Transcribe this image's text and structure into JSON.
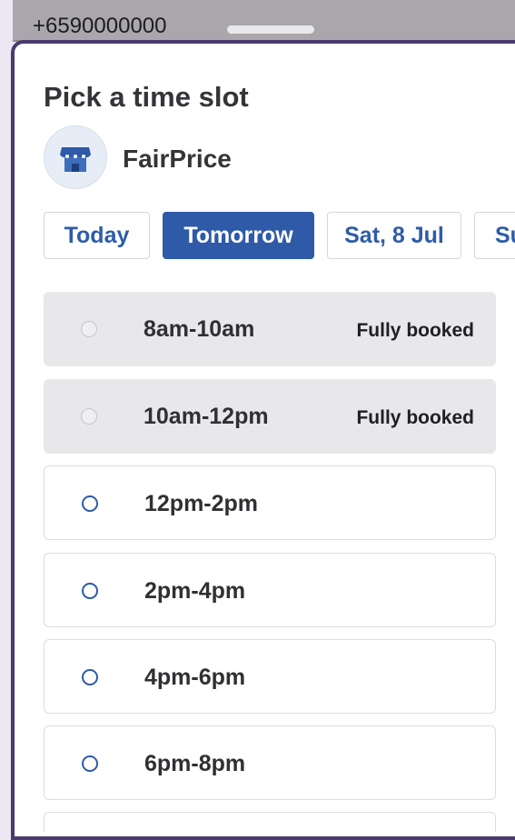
{
  "status_bar": {
    "phone_number": "+6590000000"
  },
  "sheet": {
    "title": "Pick a time slot",
    "store": {
      "name": "FairPrice",
      "icon": "storefront-icon"
    }
  },
  "date_tabs": [
    {
      "label": "Today",
      "selected": false
    },
    {
      "label": "Tomorrow",
      "selected": true
    },
    {
      "label": "Sat, 8 Jul",
      "selected": false
    },
    {
      "label": "Su",
      "selected": false
    }
  ],
  "slots": [
    {
      "label": "8am-10am",
      "status": "Fully booked",
      "available": false
    },
    {
      "label": "10am-12pm",
      "status": "Fully booked",
      "available": false
    },
    {
      "label": "12pm-2pm",
      "status": "",
      "available": true
    },
    {
      "label": "2pm-4pm",
      "status": "",
      "available": true
    },
    {
      "label": "4pm-6pm",
      "status": "",
      "available": true
    },
    {
      "label": "6pm-8pm",
      "status": "",
      "available": true
    }
  ],
  "colors": {
    "primary": "#2e5aa8",
    "booked_bg": "#e8e8ea",
    "frame": "#4a3a6d"
  }
}
